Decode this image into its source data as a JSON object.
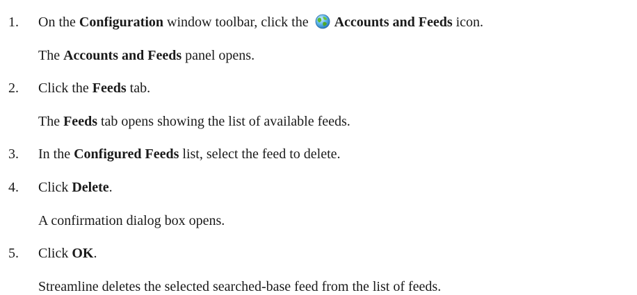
{
  "steps": [
    {
      "number": "1.",
      "parts": [
        {
          "t": "On the ",
          "b": false
        },
        {
          "t": "Configuration",
          "b": true
        },
        {
          "t": " window toolbar, click the ",
          "b": false
        },
        {
          "t": "Accounts and Feeds",
          "b": true
        },
        {
          "t": " icon.",
          "b": false
        }
      ],
      "icon": "globe-icon",
      "result": [
        {
          "t": "The ",
          "b": false
        },
        {
          "t": "Accounts and Feeds",
          "b": true
        },
        {
          "t": " panel opens.",
          "b": false
        }
      ]
    },
    {
      "number": "2.",
      "parts": [
        {
          "t": "Click the ",
          "b": false
        },
        {
          "t": "Feeds",
          "b": true
        },
        {
          "t": " tab.",
          "b": false
        }
      ],
      "result": [
        {
          "t": "The ",
          "b": false
        },
        {
          "t": "Feeds",
          "b": true
        },
        {
          "t": " tab opens showing the list of available feeds.",
          "b": false
        }
      ]
    },
    {
      "number": "3.",
      "parts": [
        {
          "t": "In the ",
          "b": false
        },
        {
          "t": "Configured Feeds",
          "b": true
        },
        {
          "t": " list, select the feed to delete.",
          "b": false
        }
      ]
    },
    {
      "number": "4.",
      "parts": [
        {
          "t": "Click ",
          "b": false
        },
        {
          "t": "Delete",
          "b": true
        },
        {
          "t": ".",
          "b": false
        }
      ],
      "result": [
        {
          "t": "A confirmation dialog box opens.",
          "b": false
        }
      ]
    },
    {
      "number": "5.",
      "parts": [
        {
          "t": "Click ",
          "b": false
        },
        {
          "t": "OK",
          "b": true
        },
        {
          "t": ".",
          "b": false
        }
      ],
      "result": [
        {
          "t": "Streamline deletes the selected searched-base feed from the list of feeds.",
          "b": false
        }
      ]
    }
  ]
}
